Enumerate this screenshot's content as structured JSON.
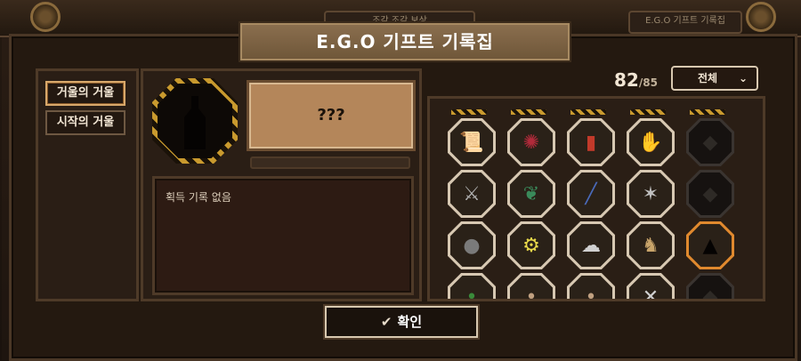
{
  "title": "E.G.O 기프트 기록집",
  "header": {
    "left_tab": "조각 조각 보상",
    "right_tab": "E.G.O 기프트 기록집"
  },
  "mirrors": [
    {
      "label": "거울의 거울",
      "active": true
    },
    {
      "label": "시작의 거울",
      "active": false
    }
  ],
  "detail": {
    "name": "???",
    "description": "획득 기록 없음"
  },
  "counter": {
    "owned": "82",
    "total": "/85"
  },
  "filter": {
    "selected": "전체"
  },
  "gifts": [
    [
      "scroll-icon",
      "tangled-rope-icon",
      "tablet-icon",
      "hand-icon",
      "locked-icon"
    ],
    [
      "sword-icon",
      "thorn-vine-icon",
      "blade-icon",
      "wire-icon",
      "locked-icon"
    ],
    [
      "stones-icon",
      "machine-icon",
      "blob-icon",
      "figure-icon",
      "bottle-icon"
    ]
  ],
  "confirm_label": "확인",
  "colors": {
    "accent": "#e0892e",
    "frame": "#4e3a28",
    "banner": "#7a6040"
  }
}
